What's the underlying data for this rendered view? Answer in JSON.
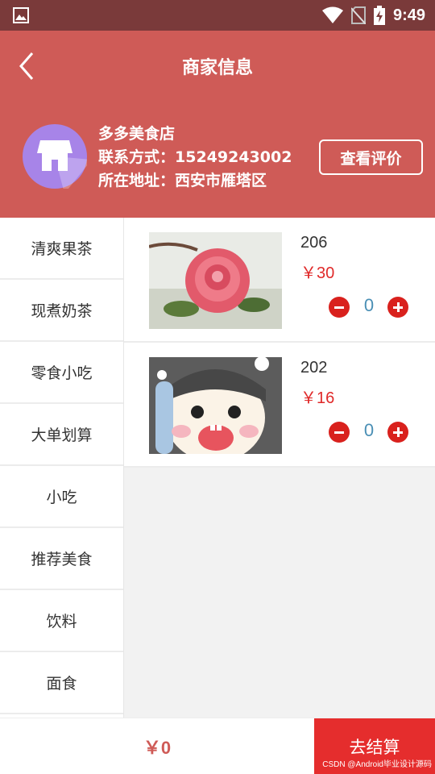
{
  "status_bar": {
    "time": "9:49"
  },
  "header": {
    "title": "商家信息"
  },
  "shop": {
    "name": "多多美食店",
    "contact": "联系方式：15249243002",
    "address": "所在地址：西安市雁塔区",
    "review_label": "查看评价"
  },
  "categories": [
    "清爽果茶",
    "现煮奶茶",
    "零食小吃",
    "大单划算",
    "小吃",
    "推荐美食",
    "饮料",
    "面食"
  ],
  "products": [
    {
      "name": "206",
      "price": "￥30",
      "qty": "0"
    },
    {
      "name": "202",
      "price": "￥16",
      "qty": "0"
    }
  ],
  "bottom": {
    "total": "￥0",
    "checkout_label": "去结算",
    "watermark": "CSDN @Android毕业设计源码"
  },
  "colors": {
    "header": "#cf5b57",
    "status_bar": "#7a3a3a",
    "accent_red": "#e52d2d"
  }
}
